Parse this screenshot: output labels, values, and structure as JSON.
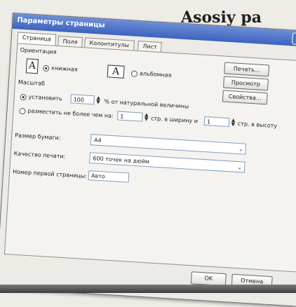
{
  "book_heading": "Asosiy pa",
  "dialog": {
    "title": "Параметры страницы",
    "help_glyph": "?",
    "close_glyph": "X",
    "tabs": [
      {
        "label": "Страница"
      },
      {
        "label": "Поля"
      },
      {
        "label": "Колонтитулы"
      },
      {
        "label": "Лист"
      }
    ],
    "orientation": {
      "label": "Ориентация",
      "portrait": "книжная",
      "landscape": "альбомная",
      "selected": "книжная",
      "icon_glyph": "A"
    },
    "scale": {
      "label": "Масштаб",
      "set_label": "установить",
      "set_value": "100",
      "percent_suffix": "% от натуральной величины",
      "fit_label": "разместить не более чем на:",
      "pages_wide_value": "1",
      "pages_wide_suffix": "стр. в ширину и",
      "pages_tall_value": "1",
      "pages_tall_suffix": "стр. в высоту"
    },
    "paper_size": {
      "label": "Размер бумаги:",
      "value": "A4"
    },
    "print_quality": {
      "label": "Качество печати:",
      "value": "600 точек на дюйм"
    },
    "first_page": {
      "label": "Номер первой страницы:",
      "value": "Авто"
    },
    "side_buttons": {
      "print": "Печать...",
      "preview": "Просмотр",
      "properties": "Свойства..."
    },
    "ok_label": "OK",
    "cancel_label": "Отмена"
  },
  "colors": {
    "titlebar": "#3b62c0",
    "close": "#c7462e"
  },
  "icons": {
    "help": "help-icon",
    "close": "close-icon",
    "portrait": "portrait-orientation-icon",
    "landscape": "landscape-orientation-icon",
    "dropdown": "chevron-down-icon"
  }
}
